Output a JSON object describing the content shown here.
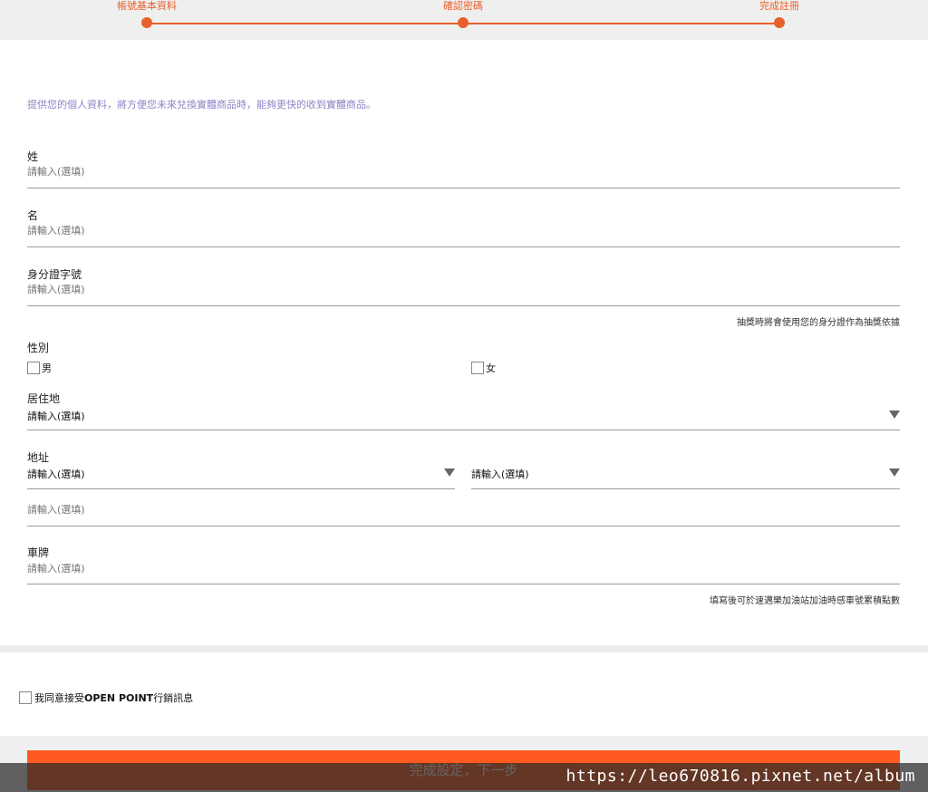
{
  "stepper": {
    "steps": [
      {
        "label": "帳號基本資料"
      },
      {
        "label": "確認密碼"
      },
      {
        "label": "完成註冊"
      }
    ],
    "accent_color": "#e8612c"
  },
  "intro": "提供您的個人資料，將方便您未來兌換實體商品時，能夠更快的收到實體商品。",
  "fields": {
    "last_name": {
      "label": "姓",
      "placeholder": "請輸入(選填)"
    },
    "first_name": {
      "label": "名",
      "placeholder": "請輸入(選填)"
    },
    "id_number": {
      "label": "身分證字號",
      "placeholder": "請輸入(選填)",
      "hint": "抽獎時將會使用您的身分證作為抽獎依據"
    },
    "gender": {
      "label": "性別",
      "options": [
        "男",
        "女"
      ]
    },
    "residence": {
      "label": "居住地",
      "selected": "請輸入(選填)"
    },
    "address": {
      "label": "地址",
      "city_selected": "請輸入(選填)",
      "district_selected": "請輸入(選填)",
      "street_placeholder": "請輸入(選填)"
    },
    "license_plate": {
      "label": "車牌",
      "placeholder": "請輸入(選填)",
      "hint": "填寫後可於速邁樂加油站加油時感車號累積點數"
    }
  },
  "consent": {
    "prefix": "我同意接受",
    "brand": "OPEN POINT",
    "suffix": "行銷訊息"
  },
  "submit_label": "完成設定，下一步",
  "watermark": "https://leo670816.pixnet.net/album",
  "button_color": "#ff5a1f"
}
